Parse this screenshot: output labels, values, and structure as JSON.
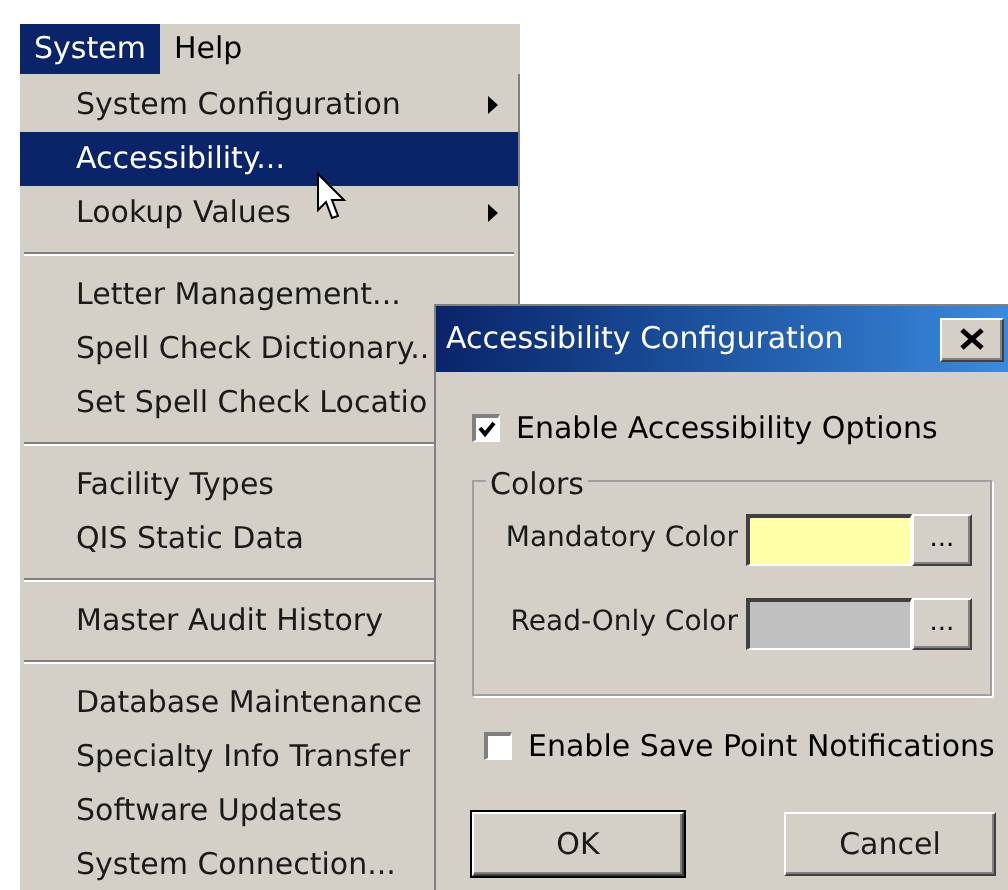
{
  "menubar": [
    {
      "label": "System",
      "selected": true
    },
    {
      "label": "Help",
      "selected": false
    }
  ],
  "menu": [
    {
      "kind": "item",
      "label": "System Configuration",
      "submenu": true,
      "selected": false
    },
    {
      "kind": "item",
      "label": "Accessibility...",
      "submenu": false,
      "selected": true
    },
    {
      "kind": "item",
      "label": "Lookup Values",
      "submenu": true,
      "selected": false
    },
    {
      "kind": "separator"
    },
    {
      "kind": "item",
      "label": "Letter Management...",
      "submenu": false,
      "selected": false
    },
    {
      "kind": "item",
      "label": "Spell Check Dictionary..",
      "submenu": false,
      "selected": false
    },
    {
      "kind": "item",
      "label": "Set Spell Check Locatio",
      "submenu": false,
      "selected": false
    },
    {
      "kind": "separator"
    },
    {
      "kind": "item",
      "label": "Facility Types",
      "submenu": false,
      "selected": false
    },
    {
      "kind": "item",
      "label": "QIS Static Data",
      "submenu": false,
      "selected": false
    },
    {
      "kind": "separator"
    },
    {
      "kind": "item",
      "label": "Master Audit History",
      "submenu": false,
      "selected": false
    },
    {
      "kind": "separator"
    },
    {
      "kind": "item",
      "label": "Database Maintenance",
      "submenu": false,
      "selected": false
    },
    {
      "kind": "item",
      "label": "Specialty Info Transfer",
      "submenu": false,
      "selected": false
    },
    {
      "kind": "item",
      "label": "Software Updates",
      "submenu": false,
      "selected": false
    },
    {
      "kind": "item",
      "label": "System Connection...",
      "submenu": false,
      "selected": false
    }
  ],
  "dialog": {
    "title": "Accessibility Configuration",
    "enable_accessibility": {
      "label": "Enable Accessibility Options",
      "checked": true
    },
    "colors_group": {
      "title": "Colors",
      "fields": [
        {
          "label": "Mandatory Color",
          "color": "#ffffa8",
          "button": "..."
        },
        {
          "label": "Read-Only Color",
          "color": "#c0c0c0",
          "button": "..."
        }
      ]
    },
    "enable_save_point": {
      "label": "Enable Save Point Notifications",
      "checked": false
    },
    "buttons": [
      "OK",
      "Cancel"
    ]
  }
}
